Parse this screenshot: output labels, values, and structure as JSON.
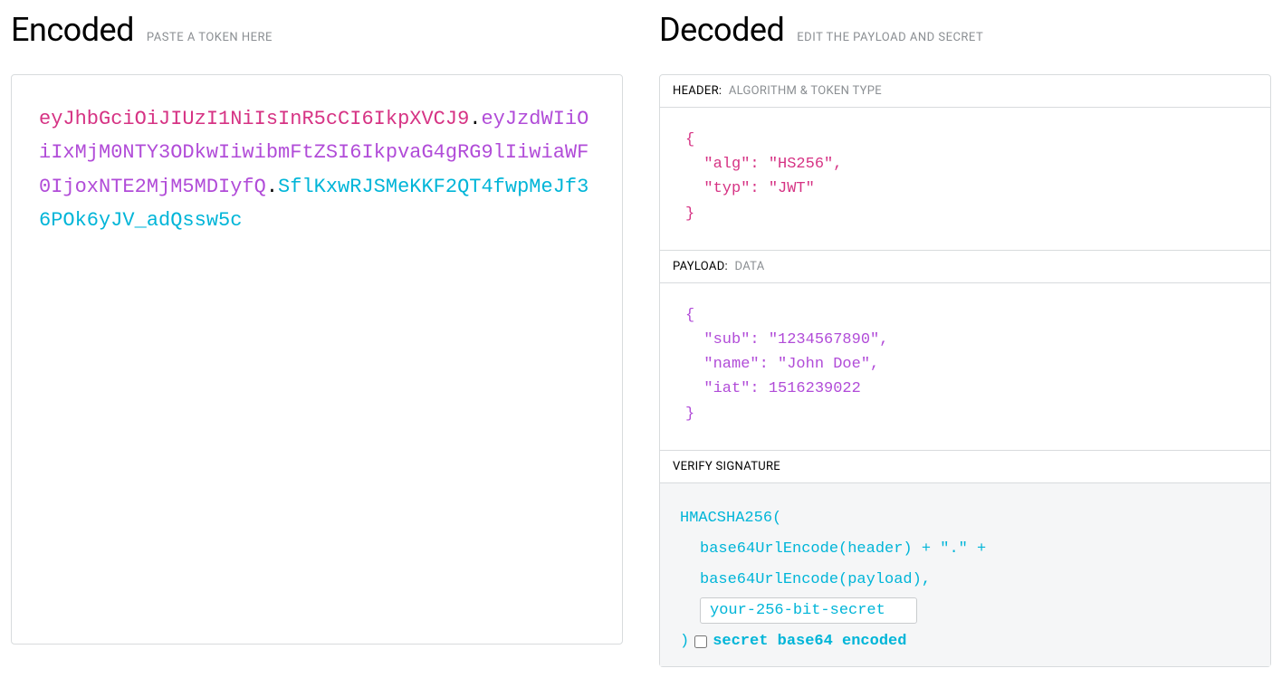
{
  "encoded": {
    "title": "Encoded",
    "subtitle": "PASTE A TOKEN HERE",
    "token": {
      "header": "eyJhbGciOiJIUzI1NiIsInR5cCI6IkpXVCJ9",
      "payload": "eyJzdWIiOiIxMjM0NTY3ODkwIiwibmFtZSI6IkpvaG4gRG9lIiwiaWF0IjoxNTE2MjM5MDIyfQ",
      "signature": "SflKxwRJSMeKKF2QT4fwpMeJf36POk6yJV_adQssw5c"
    }
  },
  "decoded": {
    "title": "Decoded",
    "subtitle": "EDIT THE PAYLOAD AND SECRET",
    "header_section": {
      "label": "HEADER:",
      "desc": "ALGORITHM & TOKEN TYPE",
      "content": "{\n  \"alg\": \"HS256\",\n  \"typ\": \"JWT\"\n}"
    },
    "payload_section": {
      "label": "PAYLOAD:",
      "desc": "DATA",
      "content": "{\n  \"sub\": \"1234567890\",\n  \"name\": \"John Doe\",\n  \"iat\": 1516239022\n}"
    },
    "signature_section": {
      "label": "VERIFY SIGNATURE",
      "line1": "HMACSHA256(",
      "line2": "base64UrlEncode(header) + \".\" +",
      "line3": "base64UrlEncode(payload),",
      "secret_value": "your-256-bit-secret",
      "close": ")",
      "base64_label": "secret base64 encoded"
    }
  }
}
